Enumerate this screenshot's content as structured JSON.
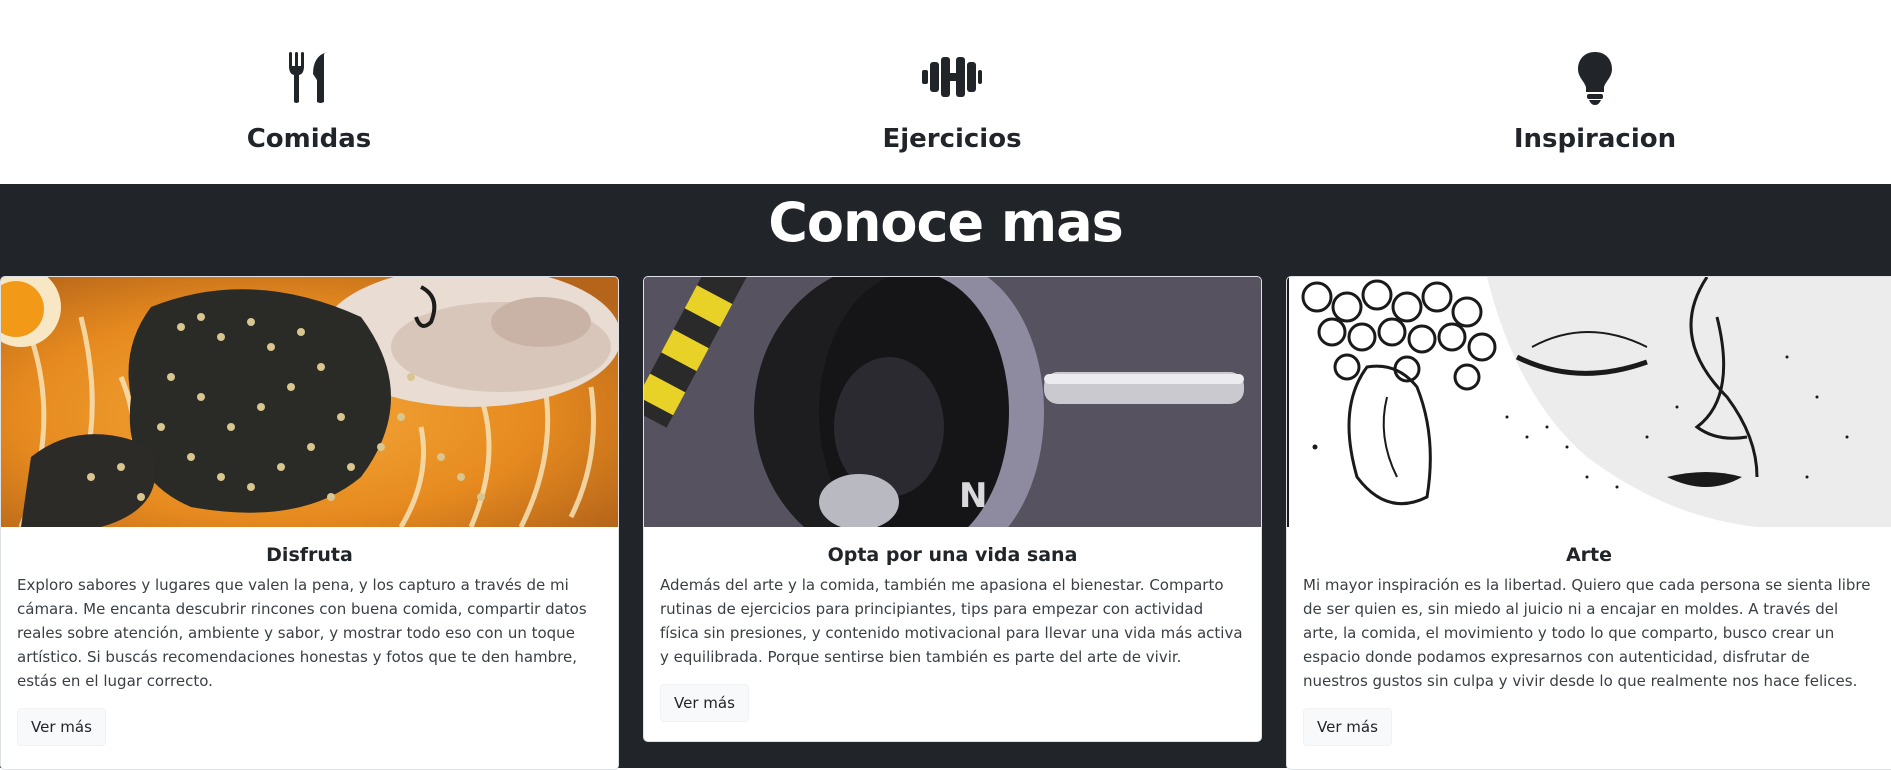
{
  "features": [
    {
      "icon": "utensils-icon",
      "title": "Comidas"
    },
    {
      "icon": "dumbbell-icon",
      "title": "Ejercicios"
    },
    {
      "icon": "lightbulb-icon",
      "title": "Inspiracion"
    }
  ],
  "section": {
    "title": "Conoce mas"
  },
  "cards": [
    {
      "image": "ramen-photo",
      "title": "Disfruta",
      "text": "Exploro sabores y lugares que valen la pena, y los capturo a través de mi cámara. Me encanta descubrir rincones con buena comida, compartir datos reales sobre atención, ambiente y sabor, y mostrar todo eso con un toque artístico. Si buscás recomendaciones honestas y fotos que te den hambre, estás en el lugar correcto.",
      "button": "Ver más"
    },
    {
      "image": "barbell-photo",
      "title": "Opta por una vida sana",
      "text": "Además del arte y la comida, también me apasiona el bienestar. Comparto rutinas de ejercicios para principiantes, tips para empezar con actividad física sin presiones, y contenido motivacional para llevar una vida más activa y equilibrada. Porque sentirse bien también es parte del arte de vivir.",
      "button": "Ver más"
    },
    {
      "image": "buddha-drawing",
      "title": "Arte",
      "text": "Mi mayor inspiración es la libertad. Quiero que cada persona se sienta libre de ser quien es, sin miedo al juicio ni a encajar en moldes. A través del arte, la comida, el movimiento y todo lo que comparto, busco crear un espacio donde podamos expresarnos con autenticidad, disfrutar de nuestros gustos sin culpa y vivir desde lo que realmente nos hace felices.",
      "button": "Ver más"
    }
  ],
  "colors": {
    "dark_section": "#212529",
    "text": "#212529",
    "button_bg": "#f8f9fa"
  }
}
